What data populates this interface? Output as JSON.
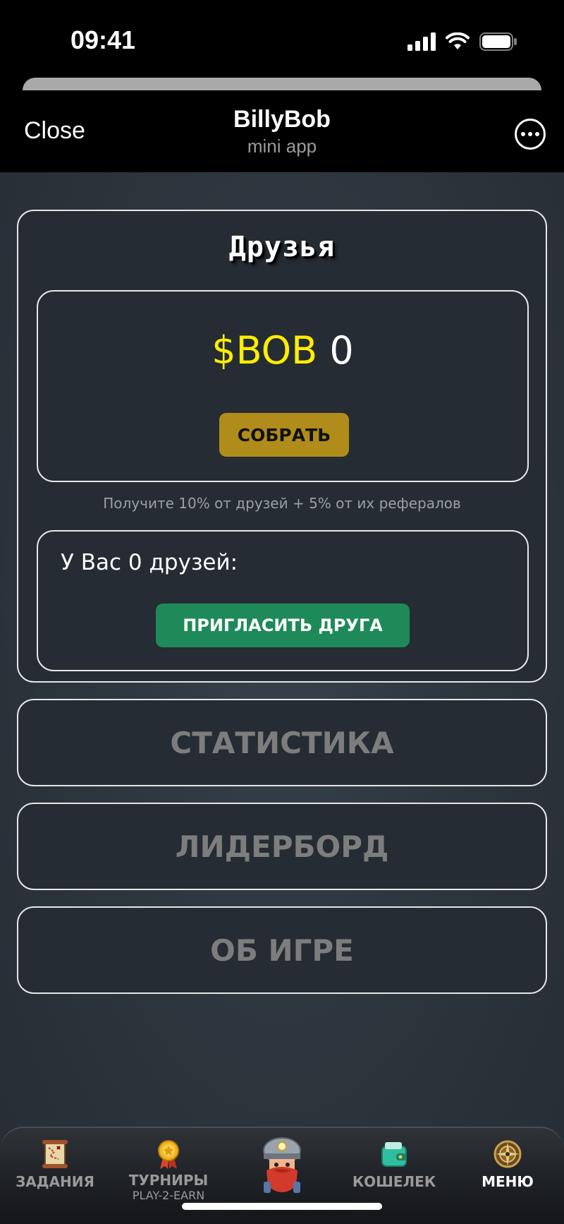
{
  "status_bar": {
    "time": "09:41"
  },
  "header": {
    "close_label": "Close",
    "title": "BillyBob",
    "subtitle": "mini app"
  },
  "friends": {
    "title": "Друзья",
    "balance_currency": "$BOB",
    "balance_amount": "0",
    "collect_label": "СОБРАТЬ",
    "referral_note": "Получите 10% от друзей + 5% от их рефералов",
    "friends_count_text": "У Вас 0 друзей:",
    "invite_label": "ПРИГЛАСИТЬ ДРУГА"
  },
  "menu": {
    "stats_label": "СТАТИСТИКА",
    "leaderboard_label": "ЛИДЕРБОРД",
    "about_label": "ОБ ИГРЕ"
  },
  "bottom_nav": {
    "items": [
      {
        "label": "ЗАДАНИЯ",
        "sublabel": "",
        "icon": "scroll-map-icon"
      },
      {
        "label": "ТУРНИРЫ",
        "sublabel": "PLAY-2-EARN",
        "icon": "medal-icon"
      },
      {
        "label": "",
        "sublabel": "",
        "icon": "miner-character-icon"
      },
      {
        "label": "КОШЕЛЕК",
        "sublabel": "",
        "icon": "wallet-icon"
      },
      {
        "label": "МЕНЮ",
        "sublabel": "",
        "icon": "compass-menu-icon"
      }
    ],
    "active": "МЕНЮ"
  },
  "colors": {
    "currency": "#ffee00",
    "collect_button": "#b08d1a",
    "invite_button": "#1f8a59",
    "menu_text_muted": "#7d7d7d"
  }
}
